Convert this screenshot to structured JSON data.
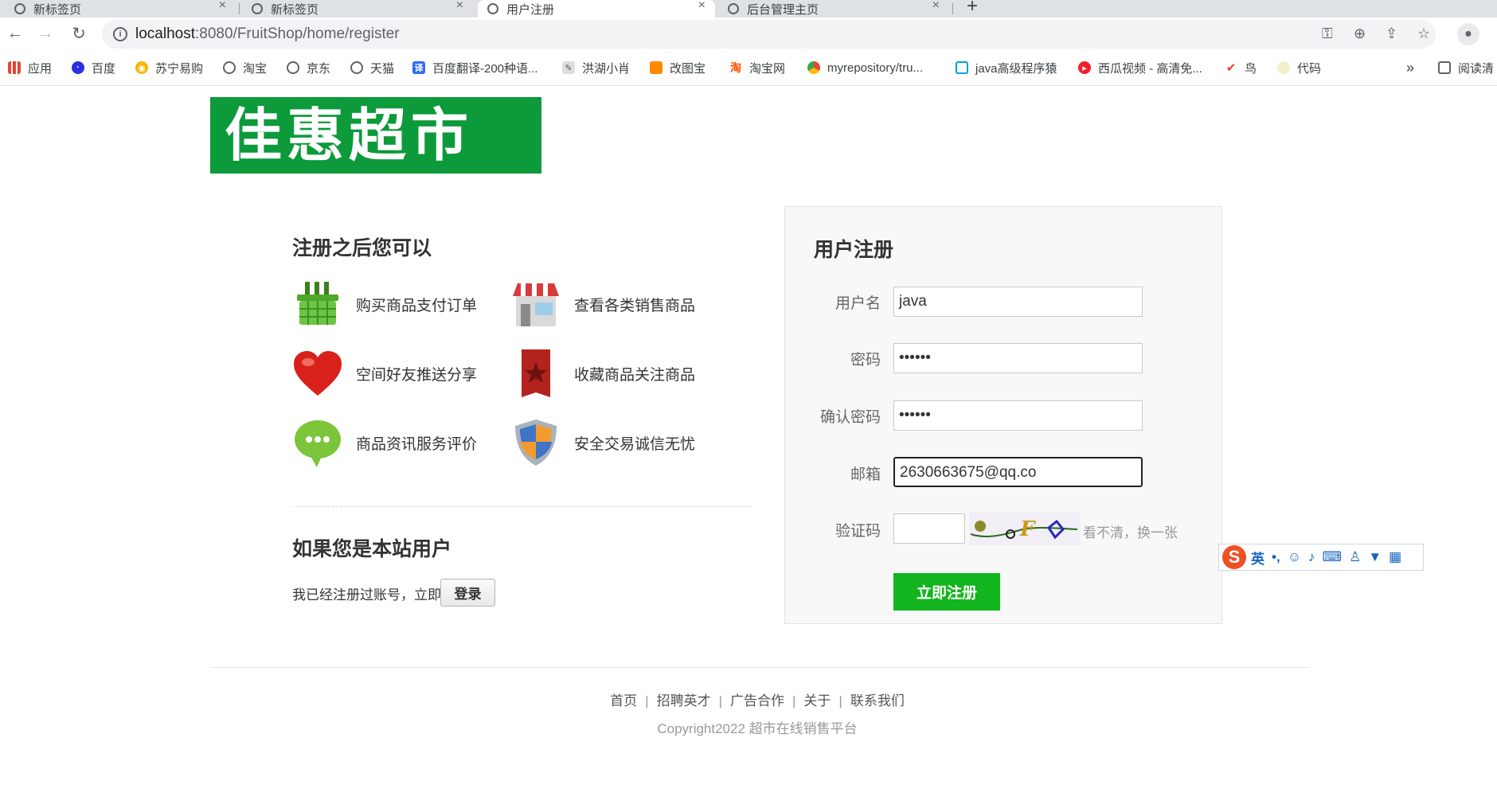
{
  "browser": {
    "tabs": [
      {
        "title": "新标签页",
        "active": false
      },
      {
        "title": "新标签页",
        "active": false
      },
      {
        "title": "用户注册",
        "active": true
      },
      {
        "title": "后台管理主页",
        "active": false
      }
    ],
    "url_host": "localhost",
    "url_path": ":8080/FruitShop/home/register",
    "bookmarks": [
      {
        "label": "应用",
        "icon": "apps-grid-icon"
      },
      {
        "label": "百度",
        "icon": "baidu-paw-icon"
      },
      {
        "label": "苏宁易购",
        "icon": "suning-icon"
      },
      {
        "label": "淘宝",
        "icon": "globe-icon"
      },
      {
        "label": "京东",
        "icon": "globe-icon"
      },
      {
        "label": "天猫",
        "icon": "globe-icon"
      },
      {
        "label": "百度翻译-200种语...",
        "icon": "translate-icon"
      },
      {
        "label": "洪湖小肖",
        "icon": "bookmark-icon"
      },
      {
        "label": "改图宝",
        "icon": "gaitubao-icon"
      },
      {
        "label": "淘宝网",
        "icon": "taobao-icon"
      },
      {
        "label": "myrepository/tru...",
        "icon": "chrome-icon"
      },
      {
        "label": "java高级程序猿",
        "icon": "bilibili-icon"
      },
      {
        "label": "西瓜视频 - 高清免...",
        "icon": "xigua-icon"
      },
      {
        "label": "鸟",
        "icon": "bird-icon"
      },
      {
        "label": "代码",
        "icon": "code-icon"
      }
    ],
    "bookmarks_overflow": "»",
    "reading_list": "阅读清"
  },
  "logo_text": "佳惠超市",
  "benefits": {
    "title": "注册之后您可以",
    "features": [
      {
        "label": "购买商品支付订单",
        "icon": "basket-icon"
      },
      {
        "label": "查看各类销售商品",
        "icon": "store-icon"
      },
      {
        "label": "空间好友推送分享",
        "icon": "heart-icon"
      },
      {
        "label": "收藏商品关注商品",
        "icon": "favorite-tag-icon"
      },
      {
        "label": "商品资讯服务评价",
        "icon": "chat-bubble-icon"
      },
      {
        "label": "安全交易诚信无忧",
        "icon": "shield-icon"
      }
    ]
  },
  "member": {
    "title": "如果您是本站用户",
    "text": "我已经注册过账号，立即",
    "login_label": "登录"
  },
  "register": {
    "title": "用户注册",
    "username_label": "用户名",
    "username_value": "java",
    "password_label": "密码",
    "password_value": "••••••",
    "confirm_label": "确认密码",
    "confirm_value": "••••••",
    "email_label": "邮箱",
    "email_value": "2630663675@qq.co",
    "captcha_label": "验证码",
    "captcha_value": "",
    "captcha_refresh": "看不清，换一张",
    "submit_label": "立即注册"
  },
  "ime": {
    "lang": "英"
  },
  "footer": {
    "links": [
      "首页",
      "招聘英才",
      "广告合作",
      "关于",
      "联系我们"
    ],
    "copyright": "Copyright2022 超市在线销售平台"
  },
  "colors": {
    "accent": "#12b51d",
    "logo_bg": "#0d9a3a",
    "logo_dot": "#f4d21f"
  }
}
